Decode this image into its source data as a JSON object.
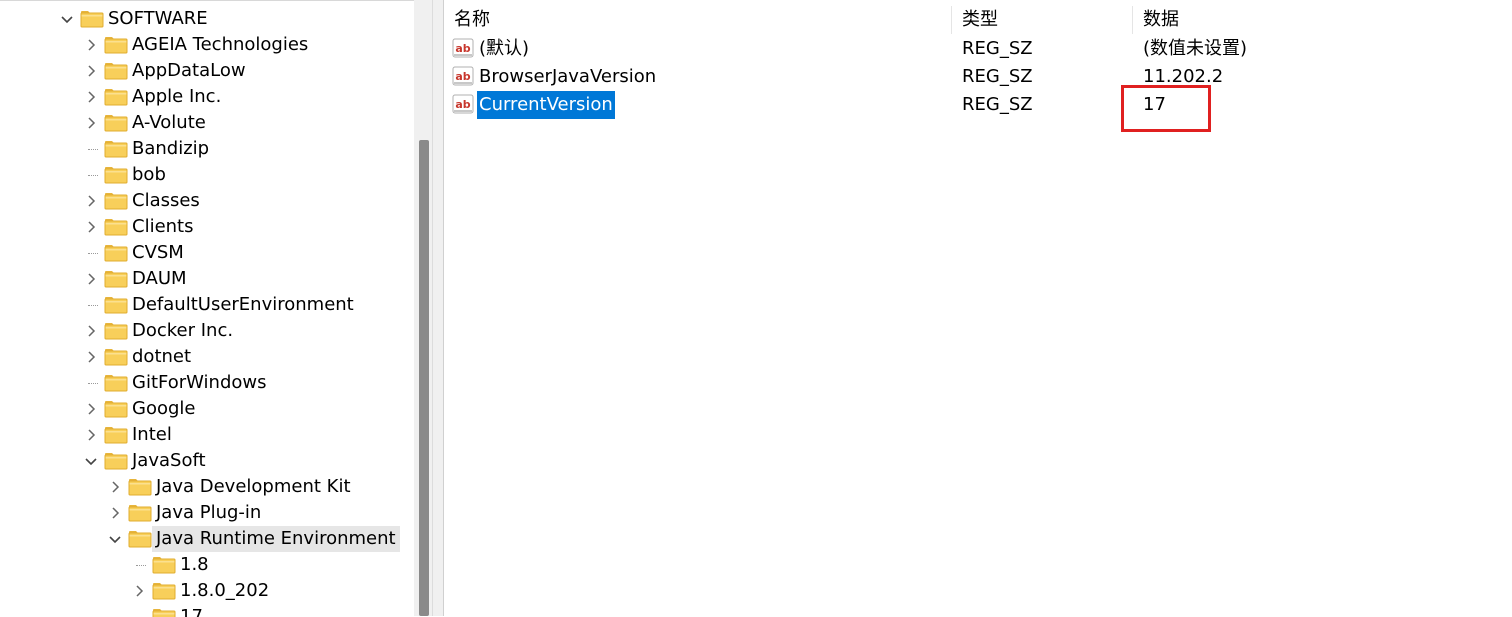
{
  "tree": {
    "items": [
      {
        "label": "SOFTWARE",
        "level": 0,
        "expander": "expanded"
      },
      {
        "label": "AGEIA Technologies",
        "level": 1,
        "expander": "collapsed"
      },
      {
        "label": "AppDataLow",
        "level": 1,
        "expander": "collapsed"
      },
      {
        "label": "Apple Inc.",
        "level": 1,
        "expander": "collapsed"
      },
      {
        "label": "A-Volute",
        "level": 1,
        "expander": "collapsed"
      },
      {
        "label": "Bandizip",
        "level": 1,
        "expander": "none"
      },
      {
        "label": "bob",
        "level": 1,
        "expander": "none"
      },
      {
        "label": "Classes",
        "level": 1,
        "expander": "collapsed"
      },
      {
        "label": "Clients",
        "level": 1,
        "expander": "collapsed"
      },
      {
        "label": "CVSM",
        "level": 1,
        "expander": "none"
      },
      {
        "label": "DAUM",
        "level": 1,
        "expander": "collapsed"
      },
      {
        "label": "DefaultUserEnvironment",
        "level": 1,
        "expander": "none"
      },
      {
        "label": "Docker Inc.",
        "level": 1,
        "expander": "collapsed"
      },
      {
        "label": "dotnet",
        "level": 1,
        "expander": "collapsed"
      },
      {
        "label": "GitForWindows",
        "level": 1,
        "expander": "none"
      },
      {
        "label": "Google",
        "level": 1,
        "expander": "collapsed"
      },
      {
        "label": "Intel",
        "level": 1,
        "expander": "collapsed"
      },
      {
        "label": "JavaSoft",
        "level": 1,
        "expander": "expanded"
      },
      {
        "label": "Java Development Kit",
        "level": 2,
        "expander": "collapsed"
      },
      {
        "label": "Java Plug-in",
        "level": 2,
        "expander": "collapsed"
      },
      {
        "label": "Java Runtime Environment",
        "level": 2,
        "expander": "expanded",
        "selected": true
      },
      {
        "label": "1.8",
        "level": 3,
        "expander": "none"
      },
      {
        "label": "1.8.0_202",
        "level": 3,
        "expander": "collapsed"
      },
      {
        "label": "17",
        "level": 3,
        "expander": "none"
      }
    ]
  },
  "list": {
    "headers": {
      "name": "名称",
      "type": "类型",
      "data": "数据"
    },
    "rows": [
      {
        "name": "(默认)",
        "type": "REG_SZ",
        "data": "(数值未设置)",
        "selected": false
      },
      {
        "name": "BrowserJavaVersion",
        "type": "REG_SZ",
        "data": "11.202.2",
        "selected": false
      },
      {
        "name": "CurrentVersion",
        "type": "REG_SZ",
        "data": "17",
        "selected": true
      }
    ]
  },
  "icons": {
    "folder": "folder-icon",
    "value": "string-value-icon",
    "expand": "chevron-right-icon",
    "collapse": "chevron-down-icon"
  },
  "colors": {
    "selection": "#0078d7",
    "highlight": "#e02020",
    "folder": "#f8cf5a"
  }
}
